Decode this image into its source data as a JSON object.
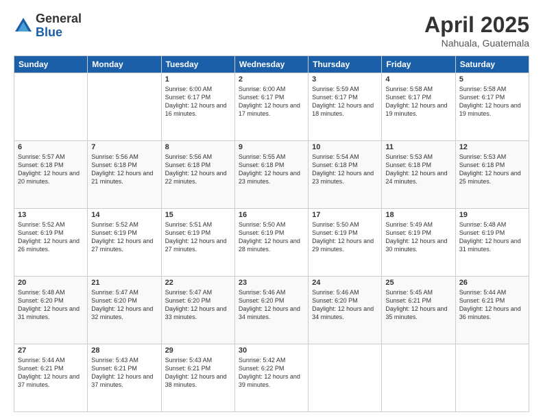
{
  "logo": {
    "general": "General",
    "blue": "Blue"
  },
  "title": "April 2025",
  "location": "Nahuala, Guatemala",
  "days": [
    "Sunday",
    "Monday",
    "Tuesday",
    "Wednesday",
    "Thursday",
    "Friday",
    "Saturday"
  ],
  "weeks": [
    [
      {
        "num": "",
        "info": ""
      },
      {
        "num": "",
        "info": ""
      },
      {
        "num": "1",
        "info": "Sunrise: 6:00 AM\nSunset: 6:17 PM\nDaylight: 12 hours and 16 minutes."
      },
      {
        "num": "2",
        "info": "Sunrise: 6:00 AM\nSunset: 6:17 PM\nDaylight: 12 hours and 17 minutes."
      },
      {
        "num": "3",
        "info": "Sunrise: 5:59 AM\nSunset: 6:17 PM\nDaylight: 12 hours and 18 minutes."
      },
      {
        "num": "4",
        "info": "Sunrise: 5:58 AM\nSunset: 6:17 PM\nDaylight: 12 hours and 19 minutes."
      },
      {
        "num": "5",
        "info": "Sunrise: 5:58 AM\nSunset: 6:17 PM\nDaylight: 12 hours and 19 minutes."
      }
    ],
    [
      {
        "num": "6",
        "info": "Sunrise: 5:57 AM\nSunset: 6:18 PM\nDaylight: 12 hours and 20 minutes."
      },
      {
        "num": "7",
        "info": "Sunrise: 5:56 AM\nSunset: 6:18 PM\nDaylight: 12 hours and 21 minutes."
      },
      {
        "num": "8",
        "info": "Sunrise: 5:56 AM\nSunset: 6:18 PM\nDaylight: 12 hours and 22 minutes."
      },
      {
        "num": "9",
        "info": "Sunrise: 5:55 AM\nSunset: 6:18 PM\nDaylight: 12 hours and 23 minutes."
      },
      {
        "num": "10",
        "info": "Sunrise: 5:54 AM\nSunset: 6:18 PM\nDaylight: 12 hours and 23 minutes."
      },
      {
        "num": "11",
        "info": "Sunrise: 5:53 AM\nSunset: 6:18 PM\nDaylight: 12 hours and 24 minutes."
      },
      {
        "num": "12",
        "info": "Sunrise: 5:53 AM\nSunset: 6:18 PM\nDaylight: 12 hours and 25 minutes."
      }
    ],
    [
      {
        "num": "13",
        "info": "Sunrise: 5:52 AM\nSunset: 6:19 PM\nDaylight: 12 hours and 26 minutes."
      },
      {
        "num": "14",
        "info": "Sunrise: 5:52 AM\nSunset: 6:19 PM\nDaylight: 12 hours and 27 minutes."
      },
      {
        "num": "15",
        "info": "Sunrise: 5:51 AM\nSunset: 6:19 PM\nDaylight: 12 hours and 27 minutes."
      },
      {
        "num": "16",
        "info": "Sunrise: 5:50 AM\nSunset: 6:19 PM\nDaylight: 12 hours and 28 minutes."
      },
      {
        "num": "17",
        "info": "Sunrise: 5:50 AM\nSunset: 6:19 PM\nDaylight: 12 hours and 29 minutes."
      },
      {
        "num": "18",
        "info": "Sunrise: 5:49 AM\nSunset: 6:19 PM\nDaylight: 12 hours and 30 minutes."
      },
      {
        "num": "19",
        "info": "Sunrise: 5:48 AM\nSunset: 6:19 PM\nDaylight: 12 hours and 31 minutes."
      }
    ],
    [
      {
        "num": "20",
        "info": "Sunrise: 5:48 AM\nSunset: 6:20 PM\nDaylight: 12 hours and 31 minutes."
      },
      {
        "num": "21",
        "info": "Sunrise: 5:47 AM\nSunset: 6:20 PM\nDaylight: 12 hours and 32 minutes."
      },
      {
        "num": "22",
        "info": "Sunrise: 5:47 AM\nSunset: 6:20 PM\nDaylight: 12 hours and 33 minutes."
      },
      {
        "num": "23",
        "info": "Sunrise: 5:46 AM\nSunset: 6:20 PM\nDaylight: 12 hours and 34 minutes."
      },
      {
        "num": "24",
        "info": "Sunrise: 5:46 AM\nSunset: 6:20 PM\nDaylight: 12 hours and 34 minutes."
      },
      {
        "num": "25",
        "info": "Sunrise: 5:45 AM\nSunset: 6:21 PM\nDaylight: 12 hours and 35 minutes."
      },
      {
        "num": "26",
        "info": "Sunrise: 5:44 AM\nSunset: 6:21 PM\nDaylight: 12 hours and 36 minutes."
      }
    ],
    [
      {
        "num": "27",
        "info": "Sunrise: 5:44 AM\nSunset: 6:21 PM\nDaylight: 12 hours and 37 minutes."
      },
      {
        "num": "28",
        "info": "Sunrise: 5:43 AM\nSunset: 6:21 PM\nDaylight: 12 hours and 37 minutes."
      },
      {
        "num": "29",
        "info": "Sunrise: 5:43 AM\nSunset: 6:21 PM\nDaylight: 12 hours and 38 minutes."
      },
      {
        "num": "30",
        "info": "Sunrise: 5:42 AM\nSunset: 6:22 PM\nDaylight: 12 hours and 39 minutes."
      },
      {
        "num": "",
        "info": ""
      },
      {
        "num": "",
        "info": ""
      },
      {
        "num": "",
        "info": ""
      }
    ]
  ]
}
